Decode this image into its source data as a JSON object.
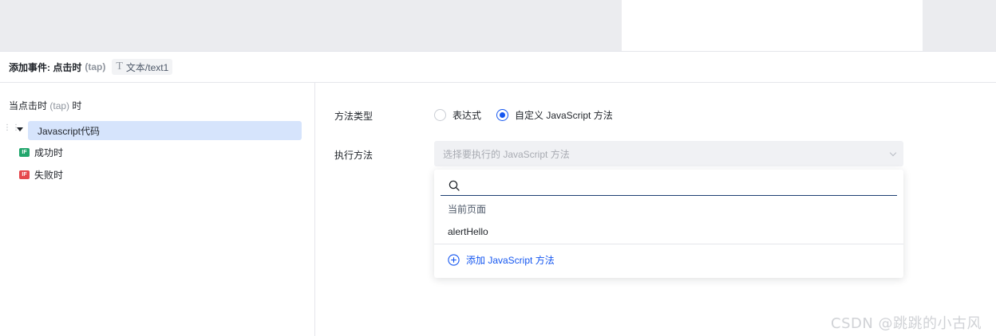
{
  "header": {
    "title": "添加事件: 点击时",
    "event_code": "(tap)",
    "target_label": "文本/text1",
    "target_icon": "text-type-icon"
  },
  "left_panel": {
    "trigger_prefix": "当点击时",
    "trigger_code": "(tap)",
    "trigger_suffix": "时",
    "action_label": "Javascript代码",
    "branches": [
      {
        "badge": "IF",
        "label": "成功时",
        "color": "#21a66c"
      },
      {
        "badge": "IF",
        "label": "失败时",
        "color": "#e5484d"
      }
    ]
  },
  "form": {
    "method_type_label": "方法类型",
    "radio_options": [
      {
        "label": "表达式",
        "checked": false
      },
      {
        "label": "自定义 JavaScript 方法",
        "checked": true
      }
    ],
    "exec_method_label": "执行方法",
    "select_placeholder": "选择要执行的 JavaScript 方法"
  },
  "dropdown": {
    "search_value": "",
    "group_label": "当前页面",
    "options": [
      "alertHello"
    ],
    "add_label": "添加 JavaScript 方法"
  },
  "watermark": "CSDN @跳跳的小古风",
  "colors": {
    "accent": "#1456f0",
    "selected_node_bg": "#d6e4fc",
    "success": "#21a66c",
    "fail": "#e5484d"
  }
}
